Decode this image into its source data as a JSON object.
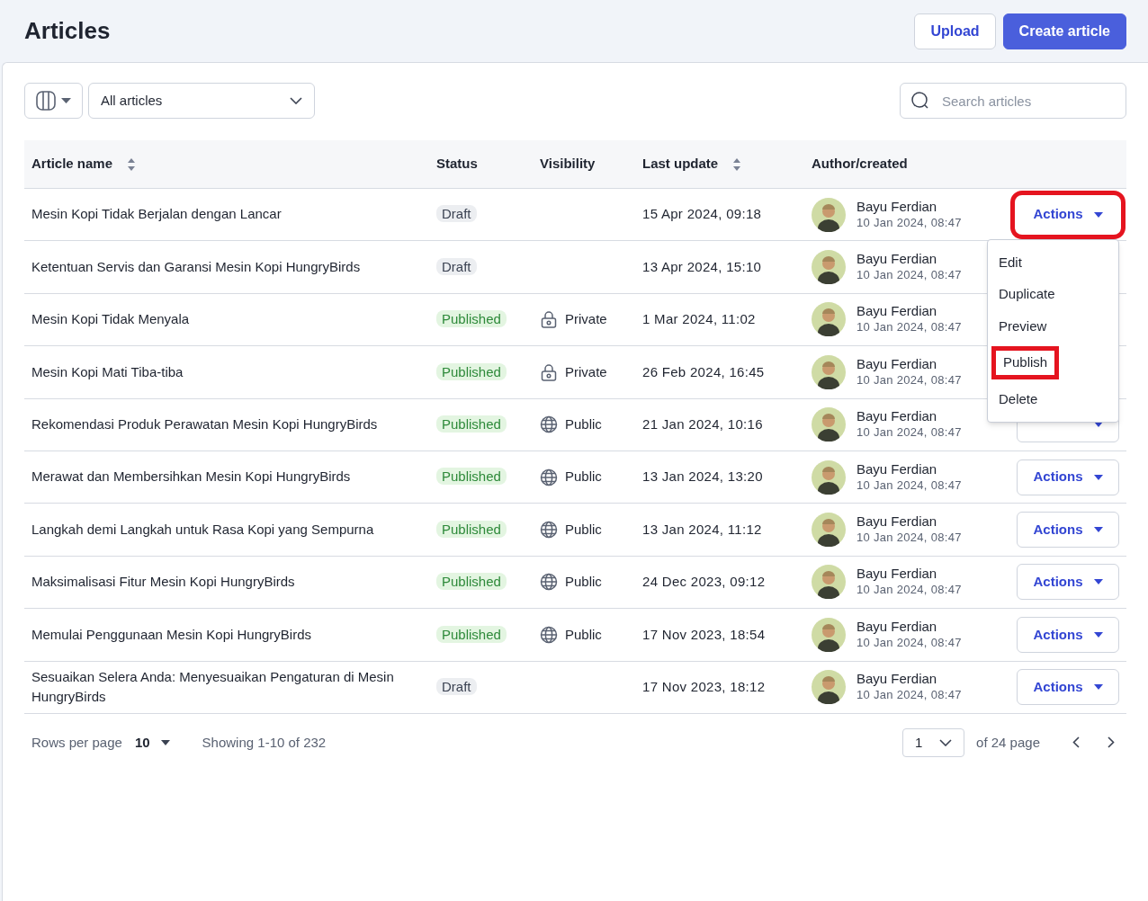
{
  "header": {
    "title": "Articles",
    "buttons": [
      {
        "label": "Upload",
        "kind": "secondary"
      },
      {
        "label": "Create article",
        "kind": "primary"
      }
    ]
  },
  "toolbar": {
    "filter": {
      "value": "All articles"
    },
    "search": {
      "placeholder": "Search articles"
    }
  },
  "table": {
    "columns": [
      {
        "label": "Article name",
        "sortable": true
      },
      {
        "label": "Status",
        "sortable": false
      },
      {
        "label": "Visibility",
        "sortable": false
      },
      {
        "label": "Last update",
        "sortable": true
      },
      {
        "label": "Author/created",
        "sortable": false
      }
    ],
    "rows": [
      {
        "name": "Mesin Kopi Tidak Berjalan dengan Lancar",
        "status": {
          "label": "Draft",
          "kind": "draft"
        },
        "last_update": "15 Apr 2024, 09:18",
        "author": "Bayu Ferdian",
        "created": "10 Jan 2024, 08:47",
        "actions": {
          "label": "Actions",
          "highlighted": true,
          "expanded": true
        }
      },
      {
        "name": "Ketentuan Servis dan Garansi Mesin Kopi HungryBirds",
        "status": {
          "label": "Draft",
          "kind": "draft"
        },
        "last_update": "13 Apr 2024, 15:10",
        "author": "Bayu Ferdian",
        "created": "10 Jan 2024, 08:47"
      },
      {
        "name": "Mesin Kopi Tidak Menyala",
        "status": {
          "label": "Published",
          "kind": "published"
        },
        "visibility": {
          "label": "Private",
          "kind": "private"
        },
        "last_update": "1 Mar 2024, 11:02",
        "author": "Bayu Ferdian",
        "created": "10 Jan 2024, 08:47"
      },
      {
        "name": "Mesin Kopi Mati Tiba-tiba",
        "status": {
          "label": "Published",
          "kind": "published"
        },
        "visibility": {
          "label": "Private",
          "kind": "private"
        },
        "last_update": "26 Feb 2024, 16:45",
        "author": "Bayu Ferdian",
        "created": "10 Jan 2024, 08:47"
      },
      {
        "name": "Rekomendasi Produk Perawatan Mesin Kopi HungryBirds",
        "status": {
          "label": "Published",
          "kind": "published"
        },
        "visibility": {
          "label": "Public",
          "kind": "public"
        },
        "last_update": "21 Jan 2024, 10:16",
        "author": "Bayu Ferdian",
        "created": "10 Jan 2024, 08:47",
        "actions": {
          "highlighted": false,
          "expanded": false
        }
      },
      {
        "name": "Merawat dan Membersihkan Mesin Kopi HungryBirds",
        "status": {
          "label": "Published",
          "kind": "published"
        },
        "visibility": {
          "label": "Public",
          "kind": "public"
        },
        "last_update": "13 Jan 2024, 13:20",
        "author": "Bayu Ferdian",
        "created": "10 Jan 2024, 08:47",
        "actions": {
          "label": "Actions",
          "highlighted": false,
          "expanded": false
        }
      },
      {
        "name": "Langkah demi Langkah untuk Rasa Kopi yang Sempurna",
        "status": {
          "label": "Published",
          "kind": "published"
        },
        "visibility": {
          "label": "Public",
          "kind": "public"
        },
        "last_update": "13 Jan 2024, 11:12",
        "author": "Bayu Ferdian",
        "created": "10 Jan 2024, 08:47",
        "actions": {
          "label": "Actions",
          "highlighted": false,
          "expanded": false
        }
      },
      {
        "name": "Maksimalisasi Fitur Mesin Kopi HungryBirds",
        "status": {
          "label": "Published",
          "kind": "published"
        },
        "visibility": {
          "label": "Public",
          "kind": "public"
        },
        "last_update": "24 Dec 2023, 09:12",
        "author": "Bayu Ferdian",
        "created": "10 Jan 2024, 08:47",
        "actions": {
          "label": "Actions",
          "highlighted": false,
          "expanded": false
        }
      },
      {
        "name": "Memulai Penggunaan Mesin Kopi HungryBirds",
        "status": {
          "label": "Published",
          "kind": "published"
        },
        "visibility": {
          "label": "Public",
          "kind": "public"
        },
        "last_update": "17 Nov 2023, 18:54",
        "author": "Bayu Ferdian",
        "created": "10 Jan 2024, 08:47",
        "actions": {
          "label": "Actions",
          "highlighted": false,
          "expanded": false
        }
      },
      {
        "name": "Sesuaikan Selera Anda: Menyesuaikan Pengaturan di Mesin HungryBirds",
        "status": {
          "label": "Draft",
          "kind": "draft"
        },
        "last_update": "17 Nov 2023, 18:12",
        "author": "Bayu Ferdian",
        "created": "10 Jan 2024, 08:47",
        "actions": {
          "label": "Actions",
          "highlighted": false,
          "expanded": false
        }
      }
    ]
  },
  "actions_menu": {
    "items": [
      {
        "label": "Edit",
        "highlighted": false
      },
      {
        "label": "Duplicate",
        "highlighted": false
      },
      {
        "label": "Preview",
        "highlighted": false
      },
      {
        "label": "Publish",
        "highlighted": true
      },
      {
        "label": "Delete",
        "highlighted": false
      }
    ]
  },
  "footer": {
    "rows_per_page_label": "Rows per page",
    "rows_per_page": "10",
    "showing": "Showing 1-10 of 232",
    "page": "1",
    "of_pages": "of 24 page"
  }
}
